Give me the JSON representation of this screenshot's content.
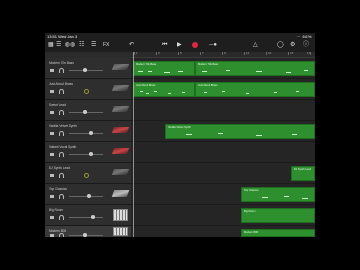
{
  "status": {
    "time": "13:51",
    "date": "Wed Jan 3",
    "battery": "66%"
  },
  "toolbar": {
    "fx_label": "FX",
    "colors": {
      "record": "#e0263a",
      "accent": "#3a8ee6"
    }
  },
  "ruler": {
    "bars": [
      "1",
      "3",
      "5",
      "7",
      "9",
      "11",
      "13",
      "15",
      "17"
    ]
  },
  "tracks": [
    {
      "name": "Modern 70s Bass",
      "instrument": "keyboard"
    },
    {
      "name": "Just About Brass",
      "instrument": "keyboard"
    },
    {
      "name": "Sweet Lead",
      "instrument": "keyboard"
    },
    {
      "name": "Vanilla Velvet Synth",
      "instrument": "keyboard"
    },
    {
      "name": "Valiant Vocal Synth",
      "instrument": "keyboard"
    },
    {
      "name": "DJ Synth Lead",
      "instrument": "keyboard"
    },
    {
      "name": "Top Classics",
      "instrument": "keyboard"
    },
    {
      "name": "Big Room",
      "instrument": "drum-pads"
    },
    {
      "name": "Modern 808",
      "instrument": "drum-pads",
      "selected": true
    }
  ],
  "regions": [
    {
      "track": 0,
      "label": "Modern 70s Bass"
    },
    {
      "track": 0,
      "label": "Modern 70s Bass"
    },
    {
      "track": 1,
      "label": "Just About Brass"
    },
    {
      "track": 1,
      "label": "Just About Brass"
    },
    {
      "track": 3,
      "label": "Vanilla Velvet Synth"
    },
    {
      "track": 5,
      "label": "DJ Synth Lead"
    },
    {
      "track": 6,
      "label": "Top Classics"
    },
    {
      "track": 7,
      "label": "Big Room"
    },
    {
      "track": 8,
      "label": "Modern 808"
    }
  ]
}
